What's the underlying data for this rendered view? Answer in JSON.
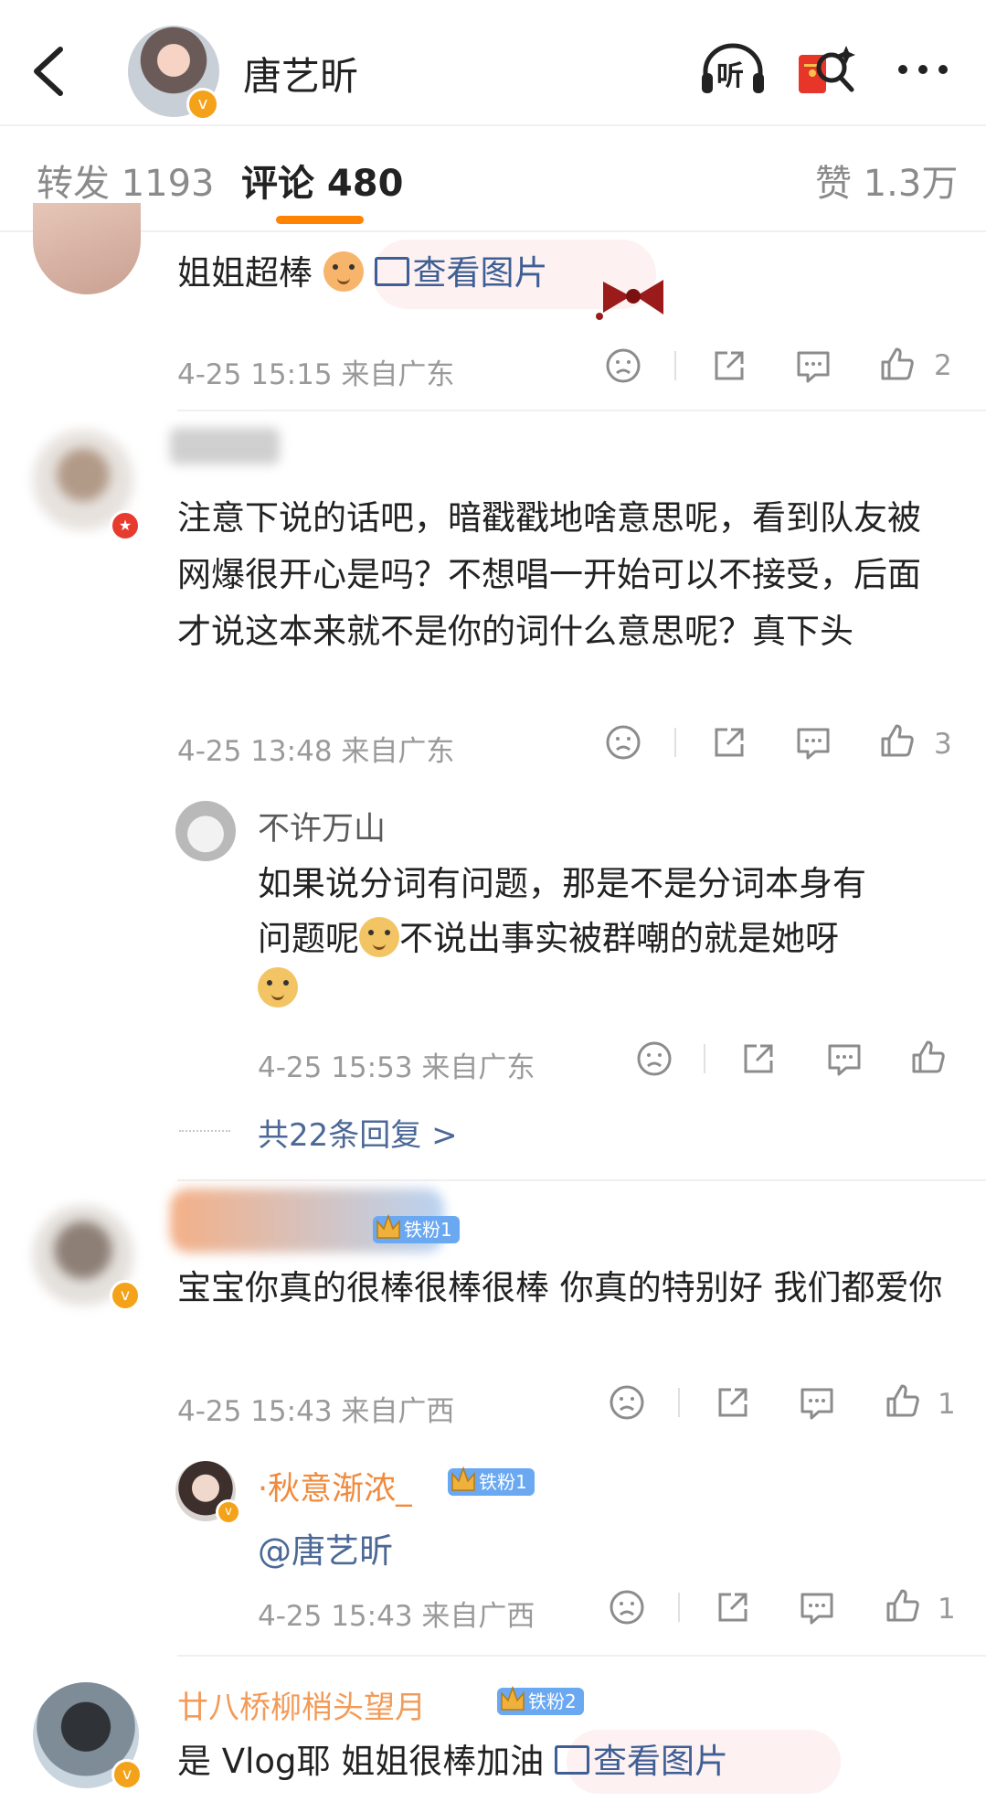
{
  "header": {
    "user_name": "唐艺昕",
    "listen_label": "听"
  },
  "tabs": {
    "repost": "转发 1193",
    "comments": "评论 480",
    "likes": "赞 1.3万"
  },
  "comments": [
    {
      "text": "姐姐超棒",
      "view_image": "查看图片",
      "meta": "4-25 15:15 来自广东",
      "likes": "2"
    },
    {
      "text": "注意下说的话吧，暗戳戳地啥意思呢，看到队友被网爆很开心是吗？不想唱一开始可以不接受，后面才说这本来就不是你的词什么意思呢？真下头",
      "meta": "4-25 13:48 来自广东",
      "likes": "3",
      "reply": {
        "name": "不许万山",
        "text_1": "如果说分词有问题，那是不是分词本身有",
        "text_2a": "问题呢",
        "text_2b": "不说出事实被群嘲的就是她呀",
        "meta": "4-25 15:53 来自广东"
      },
      "more_replies": "共22条回复 >"
    },
    {
      "fan_badge": "铁粉1",
      "text": "宝宝你真的很棒很棒很棒 你真的特别好 我们都爱你",
      "meta": "4-25 15:43 来自广西",
      "likes": "1",
      "reply": {
        "name": "·秋意渐浓_",
        "fan_badge": "铁粉1",
        "text": "@唐艺昕",
        "meta": "4-25 15:43 来自广西",
        "likes": "1"
      }
    },
    {
      "name": "廿八桥柳梢头望月",
      "fan_badge": "铁粉2",
      "text": "是 Vlog耶 姐姐很棒加油",
      "view_image": "查看图片"
    }
  ],
  "colors": {
    "accent": "#ff8200",
    "link": "#4b6896",
    "meta": "#9a9a9a",
    "fan_badge": "#6aa8f2",
    "reply_name_orange": "#f08a3c"
  }
}
